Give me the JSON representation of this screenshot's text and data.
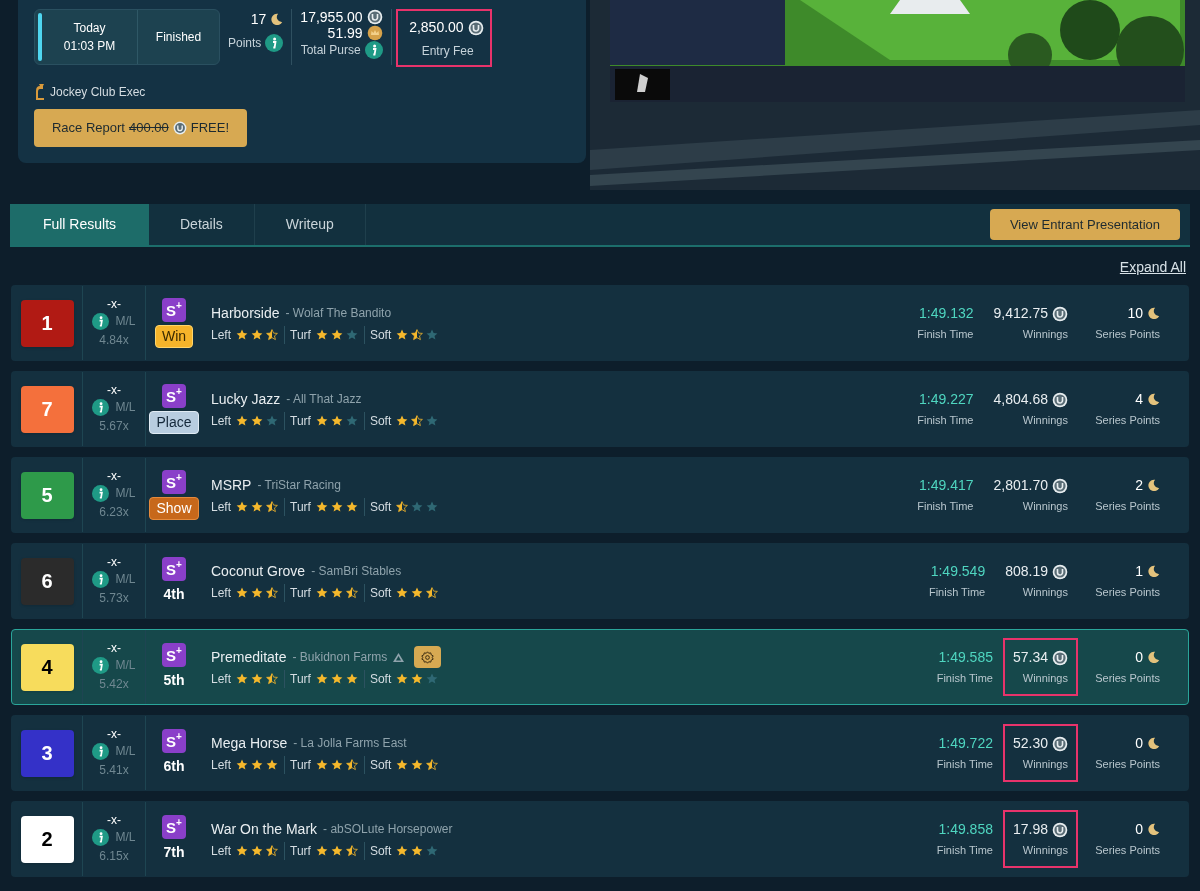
{
  "race": {
    "date": "Today",
    "time": "01:03 PM",
    "status": "Finished",
    "points": "17",
    "points_label": "Points",
    "purse": "17,955.00",
    "purse_secondary": "51.99",
    "purse_label": "Total Purse",
    "entry_fee": "2,850.00",
    "entry_fee_label": "Entry Fee",
    "entry_fee_highlighted": true,
    "club": "Jockey Club Exec",
    "report_button": {
      "label": "Race Report",
      "old_price": "400.00",
      "offer": "FREE!"
    }
  },
  "tabs": [
    {
      "label": "Full Results",
      "selected": true
    },
    {
      "label": "Details",
      "selected": false
    },
    {
      "label": "Writeup",
      "selected": false
    }
  ],
  "presentation_button": "View Entrant Presentation",
  "expand_all": "Expand All",
  "results": [
    {
      "post": "1",
      "color": "#b11a14",
      "odds": "-x-",
      "ml_label": "M/L",
      "ml_odds": "4.84x",
      "badge": "S$^{+}$",
      "placing": "Win",
      "kind": "win",
      "horse": "Harborside",
      "owner": "- Wolaf The Bandito",
      "owner_marked": false,
      "settings_button": false,
      "selected": false,
      "ratings": [
        {
          "label": "Left",
          "stars": 2.5
        },
        {
          "label": "Turf",
          "stars": 2
        },
        {
          "label": "Soft",
          "stars": 1.5
        }
      ],
      "time": "1:49.132",
      "time_label": "Finish Time",
      "winnings": "9,412.75",
      "winnings_label": "Winnings",
      "winnings_highlighted": false,
      "points": "10",
      "points_label": "Series Points"
    },
    {
      "post": "7",
      "color": "#f4703c",
      "odds": "-x-",
      "ml_label": "M/L",
      "ml_odds": "5.67x",
      "badge": "S$^{+}$",
      "placing": "Place",
      "kind": "place",
      "horse": "Lucky Jazz",
      "owner": "- All That Jazz",
      "owner_marked": false,
      "settings_button": false,
      "selected": false,
      "ratings": [
        {
          "label": "Left",
          "stars": 2
        },
        {
          "label": "Turf",
          "stars": 2
        },
        {
          "label": "Soft",
          "stars": 1.5
        }
      ],
      "time": "1:49.227",
      "time_label": "Finish Time",
      "winnings": "4,804.68",
      "winnings_label": "Winnings",
      "winnings_highlighted": false,
      "points": "4",
      "points_label": "Series Points"
    },
    {
      "post": "5",
      "color": "#2e9a4a",
      "odds": "-x-",
      "ml_label": "M/L",
      "ml_odds": "6.23x",
      "badge": "S$^{+}$",
      "placing": "Show",
      "kind": "show",
      "horse": "MSRP",
      "owner": "- TriStar Racing",
      "owner_marked": false,
      "settings_button": false,
      "selected": false,
      "ratings": [
        {
          "label": "Left",
          "stars": 2.5
        },
        {
          "label": "Turf",
          "stars": 3
        },
        {
          "label": "Soft",
          "stars": 0.5
        }
      ],
      "time": "1:49.417",
      "time_label": "Finish Time",
      "winnings": "2,801.70",
      "winnings_label": "Winnings",
      "winnings_highlighted": false,
      "points": "2",
      "points_label": "Series Points"
    },
    {
      "post": "6",
      "color": "#2b2b2b",
      "odds": "-x-",
      "ml_label": "M/L",
      "ml_odds": "5.73x",
      "badge": "S$^{+}$",
      "placing": "4th",
      "kind": "plain",
      "horse": "Coconut Grove",
      "owner": "- SamBri Stables",
      "owner_marked": false,
      "settings_button": false,
      "selected": false,
      "ratings": [
        {
          "label": "Left",
          "stars": 2.5
        },
        {
          "label": "Turf",
          "stars": 2.5
        },
        {
          "label": "Soft",
          "stars": 2.5
        }
      ],
      "time": "1:49.549",
      "time_label": "Finish Time",
      "winnings": "808.19",
      "winnings_label": "Winnings",
      "winnings_highlighted": false,
      "points": "1",
      "points_label": "Series Points"
    },
    {
      "post": "4",
      "color": "#f7dc5c",
      "odds": "-x-",
      "ml_label": "M/L",
      "ml_odds": "5.42x",
      "badge": "S$^{+}$",
      "placing": "5th",
      "kind": "plain",
      "horse": "Premeditate",
      "owner": "- Bukidnon Farms",
      "owner_marked": true,
      "settings_button": true,
      "selected": true,
      "ratings": [
        {
          "label": "Left",
          "stars": 2.5
        },
        {
          "label": "Turf",
          "stars": 3
        },
        {
          "label": "Soft",
          "stars": 2
        }
      ],
      "time": "1:49.585",
      "time_label": "Finish Time",
      "winnings": "57.34",
      "winnings_label": "Winnings",
      "winnings_highlighted": true,
      "points": "0",
      "points_label": "Series Points"
    },
    {
      "post": "3",
      "color": "#3431c8",
      "odds": "-x-",
      "ml_label": "M/L",
      "ml_odds": "5.41x",
      "badge": "S$^{+}$",
      "placing": "6th",
      "kind": "plain",
      "horse": "Mega Horse",
      "owner": "- La Jolla Farms East",
      "owner_marked": false,
      "settings_button": false,
      "selected": false,
      "ratings": [
        {
          "label": "Left",
          "stars": 3
        },
        {
          "label": "Turf",
          "stars": 2.5
        },
        {
          "label": "Soft",
          "stars": 2.5
        }
      ],
      "time": "1:49.722",
      "time_label": "Finish Time",
      "winnings": "52.30",
      "winnings_label": "Winnings",
      "winnings_highlighted": true,
      "points": "0",
      "points_label": "Series Points"
    },
    {
      "post": "2",
      "color": "#ffffff",
      "odds": "-x-",
      "ml_label": "M/L",
      "ml_odds": "6.15x",
      "badge": "S$^{+}$",
      "placing": "7th",
      "kind": "plain",
      "horse": "War On the Mark",
      "owner": "- abSOLute Horsepower",
      "owner_marked": false,
      "settings_button": false,
      "selected": false,
      "ratings": [
        {
          "label": "Left",
          "stars": 2.5
        },
        {
          "label": "Turf",
          "stars": 2.5
        },
        {
          "label": "Soft",
          "stars": 2
        }
      ],
      "time": "1:49.858",
      "time_label": "Finish Time",
      "winnings": "17.98",
      "winnings_label": "Winnings",
      "winnings_highlighted": true,
      "points": "0",
      "points_label": "Series Points"
    }
  ]
}
